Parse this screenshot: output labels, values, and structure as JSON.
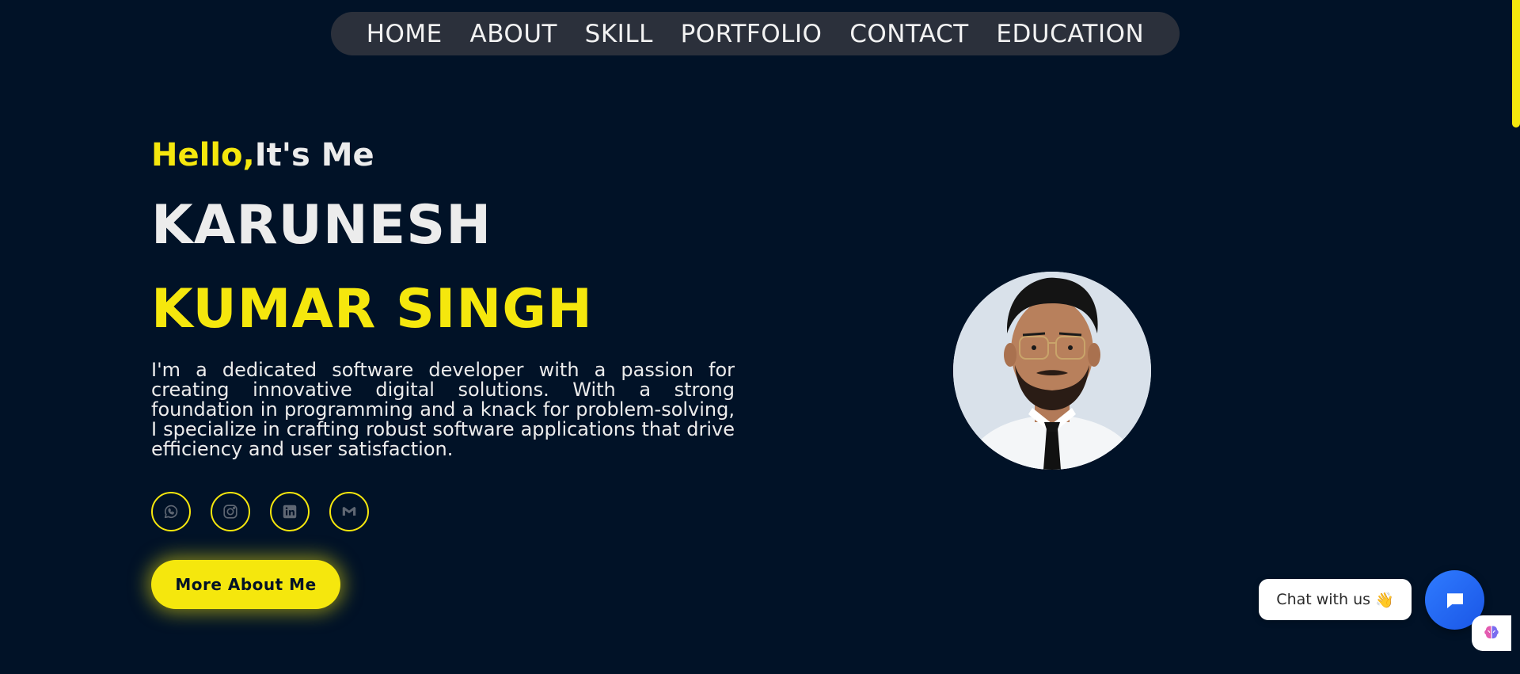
{
  "nav": {
    "items": [
      "HOME",
      "ABOUT",
      "SKILL",
      "PORTFOLIO",
      "CONTACT",
      "EDUCATION"
    ]
  },
  "hero": {
    "greeting_highlight": "Hello,",
    "greeting_rest": "It's Me",
    "name_first": "KARUNESH",
    "name_rest": "KUMAR SINGH",
    "bio": "I'm a dedicated software developer with a passion for creating innovative digital solutions. With a strong foundation in programming and a knack for problem-solving, I specialize in crafting robust software applications that drive efficiency and user satisfaction.",
    "cta_label": "More About Me"
  },
  "socials": [
    {
      "icon": "whatsapp-icon"
    },
    {
      "icon": "instagram-icon"
    },
    {
      "icon": "linkedin-icon"
    },
    {
      "icon": "gmail-icon"
    }
  ],
  "chat": {
    "label": "Chat with us",
    "emoji": "👋"
  },
  "colors": {
    "background": "#011227",
    "accent": "#f5e70d",
    "nav_bg": "#2b303b",
    "chat_blue": "#1a56e6"
  }
}
